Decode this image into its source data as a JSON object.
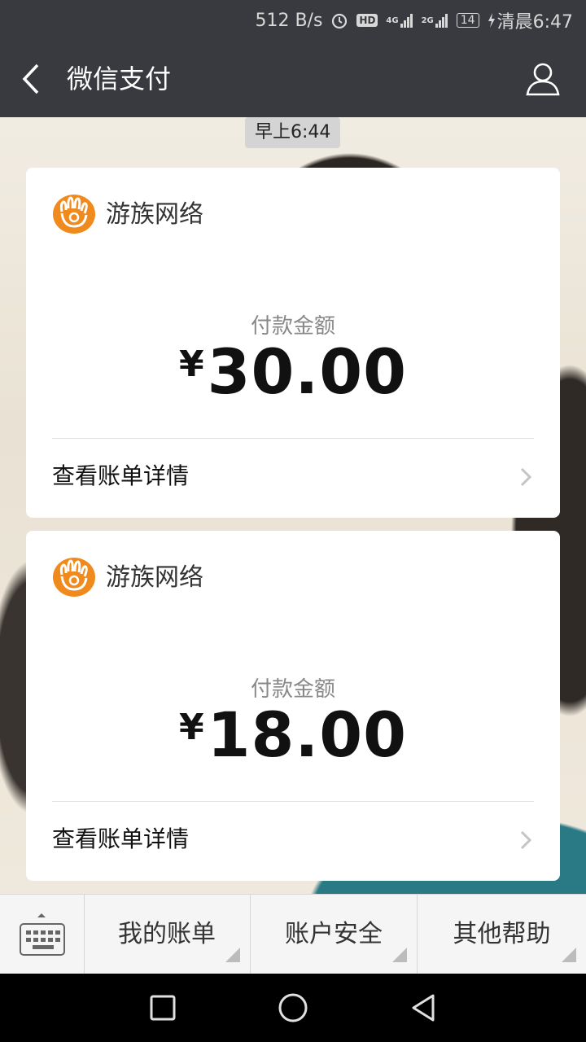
{
  "status_bar": {
    "net_speed": "512 B/s",
    "hd": "HD",
    "signal1": "4G",
    "signal2": "2G",
    "battery": "14",
    "time": "清晨6:47"
  },
  "header": {
    "title": "微信支付"
  },
  "chat": {
    "timestamp": "早上6:44",
    "cards": [
      {
        "merchant": "游族网络",
        "amount_label": "付款金额",
        "currency": "¥",
        "amount": "30.00",
        "detail_link": "查看账单详情"
      },
      {
        "merchant": "游族网络",
        "amount_label": "付款金额",
        "currency": "¥",
        "amount": "18.00",
        "detail_link": "查看账单详情"
      }
    ]
  },
  "menu": {
    "items": [
      {
        "label": "我的账单"
      },
      {
        "label": "账户安全"
      },
      {
        "label": "其他帮助"
      }
    ]
  },
  "colors": {
    "bar": "#393a3f",
    "logo": "#f08a1c",
    "card": "#ffffff"
  }
}
